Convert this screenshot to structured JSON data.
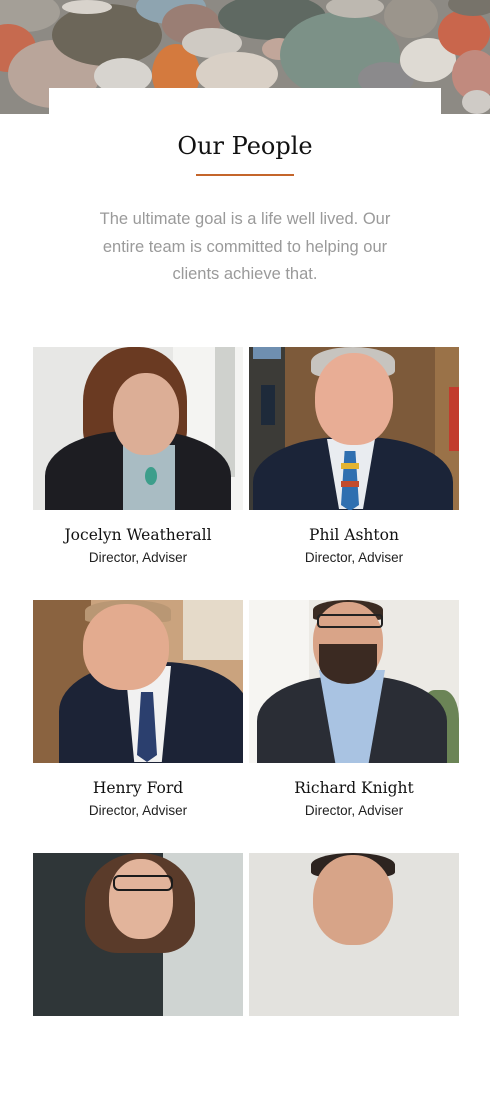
{
  "page": {
    "title": "Our People",
    "intro": "The ultimate goal is a life well lived. Our entire team is committed to helping our clients achieve that.",
    "accent_color": "#c4652b"
  },
  "people": [
    {
      "name": "Jocelyn Weatherall",
      "role": "Director, Adviser"
    },
    {
      "name": "Phil Ashton",
      "role": "Director, Adviser"
    },
    {
      "name": "Henry Ford",
      "role": "Director, Adviser"
    },
    {
      "name": "Richard Knight",
      "role": "Director, Adviser"
    },
    {
      "name": "",
      "role": ""
    },
    {
      "name": "",
      "role": ""
    }
  ]
}
